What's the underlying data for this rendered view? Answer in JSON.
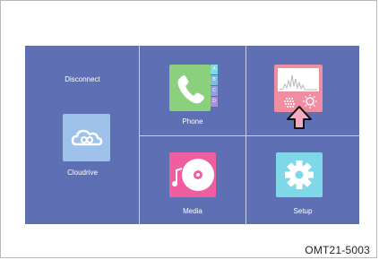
{
  "screen": {
    "disconnect_label": "Disconnect",
    "cloudrive_label": "Cloudrive",
    "phone_label": "Phone",
    "phone_tabs": [
      "A",
      "B",
      "C",
      "D"
    ],
    "media_label": "Media",
    "setup_label": "Setup"
  },
  "caption": "OMT21-5003",
  "colors": {
    "screen_bg": "#5f6fb4",
    "phone_green": "#8bd07c",
    "cloud_blue": "#9fc2ea",
    "media_pink": "#ef5f9f",
    "setup_cyan": "#7fd8e8",
    "voice_pink": "#f08da0"
  }
}
